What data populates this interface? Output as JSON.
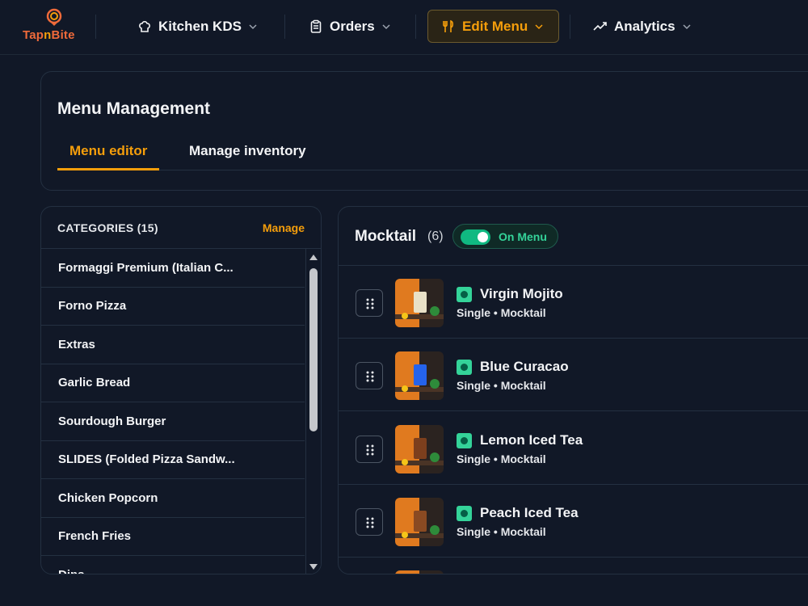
{
  "app": {
    "logo_part1": "Tap",
    "logo_part2": "n",
    "logo_part3": "Bite"
  },
  "nav": {
    "items": [
      {
        "label": "Kitchen KDS",
        "icon": "chef-hat-icon"
      },
      {
        "label": "Orders",
        "icon": "clipboard-icon"
      },
      {
        "label": "Edit Menu",
        "icon": "utensils-icon",
        "active": true
      },
      {
        "label": "Analytics",
        "icon": "trending-up-icon"
      }
    ]
  },
  "page": {
    "title": "Menu Management",
    "tabs": [
      {
        "label": "Menu editor",
        "active": true
      },
      {
        "label": "Manage inventory"
      }
    ]
  },
  "categories": {
    "title": "CATEGORIES (15)",
    "manage_label": "Manage",
    "items": [
      "Formaggi Premium (Italian C...",
      "Forno Pizza",
      "Extras",
      "Garlic Bread",
      "Sourdough Burger",
      "SLIDES (Folded Pizza Sandw...",
      "Chicken Popcorn",
      "French Fries",
      "Dips"
    ]
  },
  "menu_items": {
    "category": "Mocktail",
    "count": "(6)",
    "status_label": "On Menu",
    "items": [
      {
        "name": "Virgin Mojito",
        "sub": "Single • Mocktail",
        "drink_color": "#e9e1c7"
      },
      {
        "name": "Blue Curacao",
        "sub": "Single • Mocktail",
        "drink_color": "#2563eb"
      },
      {
        "name": "Lemon Iced Tea",
        "sub": "Single • Mocktail",
        "drink_color": "#7c3f1d"
      },
      {
        "name": "Peach Iced Tea",
        "sub": "Single • Mocktail",
        "drink_color": "#8a4a22"
      }
    ]
  },
  "colors": {
    "accent": "#f59e0b",
    "background": "#111827",
    "success": "#10b981"
  }
}
